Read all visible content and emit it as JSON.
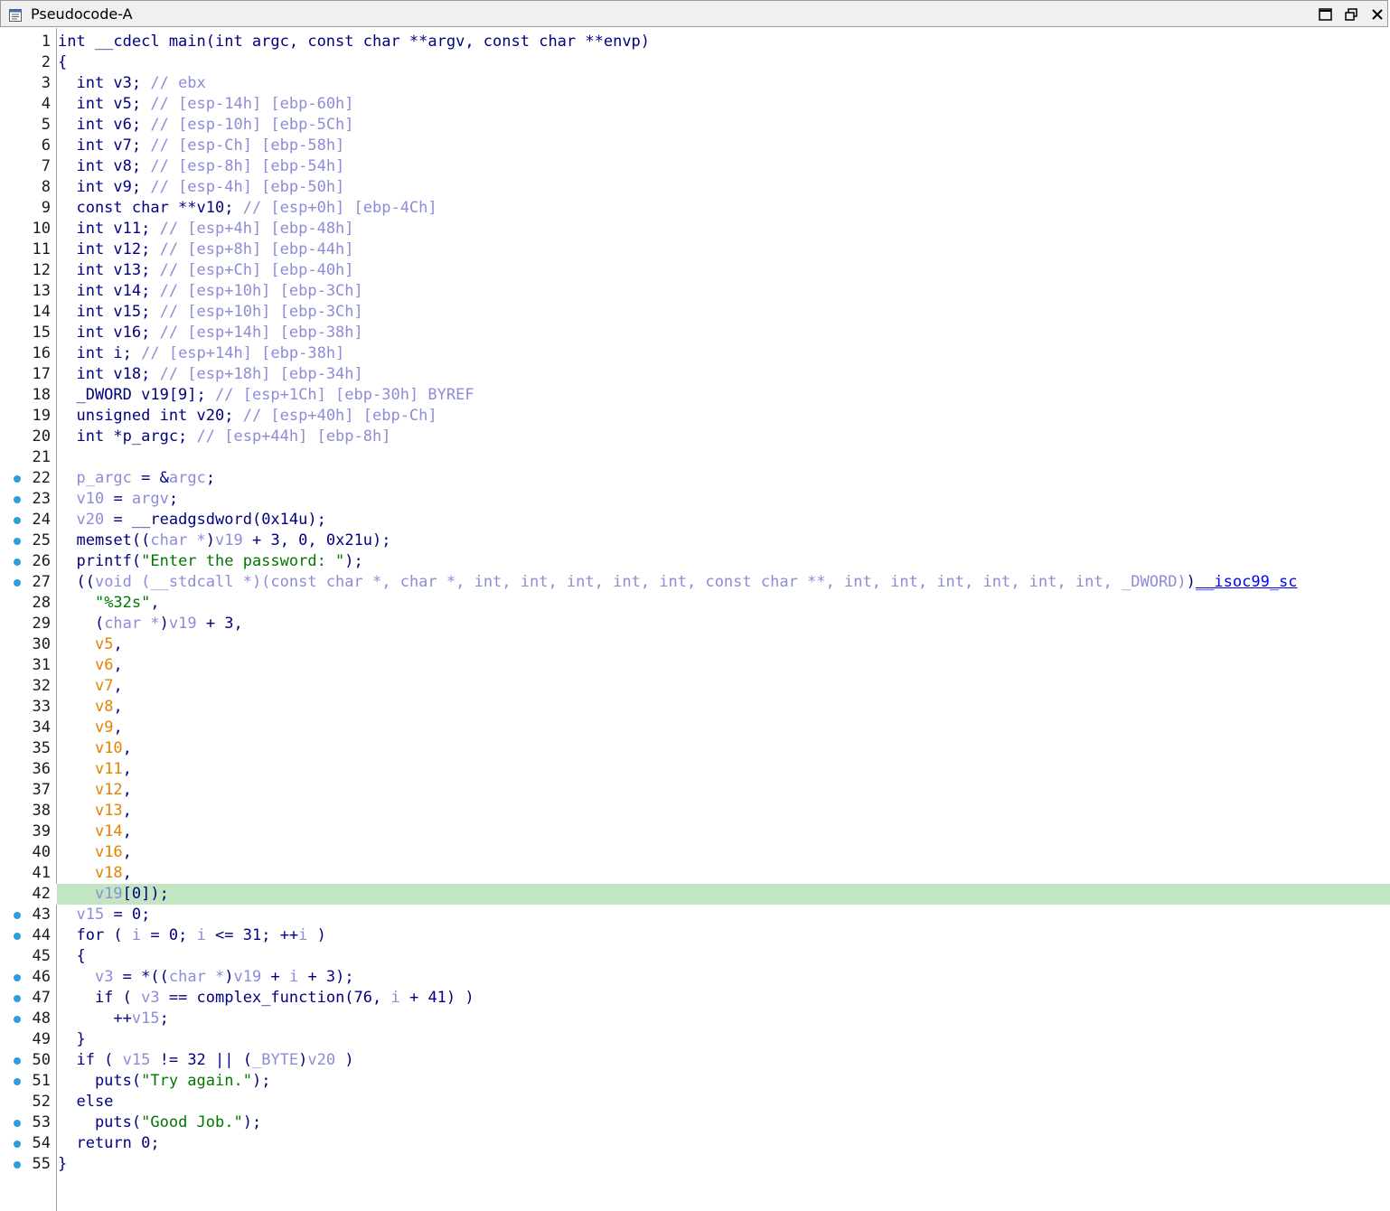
{
  "window": {
    "title": "Pseudocode-A",
    "icon": "pseudocode-view-icon",
    "buttons": [
      "maximize-icon",
      "restore-icon",
      "close-icon"
    ]
  },
  "colors": {
    "keyword": "#000080",
    "comment": "#8c8cd8",
    "variable": "#8c8cd8",
    "argument": "#e68000",
    "string": "#007700",
    "highlight_line": "#c2e6c2",
    "breakpoint_dot": "#2a9fe0"
  },
  "highlighted_line": "42",
  "lines": [
    {
      "n": "1",
      "dot": false,
      "t": [
        [
          "k",
          "int __cdecl main(int argc, const char **argv, const char **envp)"
        ]
      ]
    },
    {
      "n": "2",
      "dot": false,
      "t": [
        [
          "k",
          "{"
        ]
      ]
    },
    {
      "n": "3",
      "dot": false,
      "t": [
        [
          "k",
          "  int v3; "
        ],
        [
          "c",
          "// ebx"
        ]
      ]
    },
    {
      "n": "4",
      "dot": false,
      "t": [
        [
          "k",
          "  int v5; "
        ],
        [
          "c",
          "// [esp-14h] [ebp-60h]"
        ]
      ]
    },
    {
      "n": "5",
      "dot": false,
      "t": [
        [
          "k",
          "  int v6; "
        ],
        [
          "c",
          "// [esp-10h] [ebp-5Ch]"
        ]
      ]
    },
    {
      "n": "6",
      "dot": false,
      "t": [
        [
          "k",
          "  int v7; "
        ],
        [
          "c",
          "// [esp-Ch] [ebp-58h]"
        ]
      ]
    },
    {
      "n": "7",
      "dot": false,
      "t": [
        [
          "k",
          "  int v8; "
        ],
        [
          "c",
          "// [esp-8h] [ebp-54h]"
        ]
      ]
    },
    {
      "n": "8",
      "dot": false,
      "t": [
        [
          "k",
          "  int v9; "
        ],
        [
          "c",
          "// [esp-4h] [ebp-50h]"
        ]
      ]
    },
    {
      "n": "9",
      "dot": false,
      "t": [
        [
          "k",
          "  const char **v10; "
        ],
        [
          "c",
          "// [esp+0h] [ebp-4Ch]"
        ]
      ]
    },
    {
      "n": "10",
      "dot": false,
      "t": [
        [
          "k",
          "  int v11; "
        ],
        [
          "c",
          "// [esp+4h] [ebp-48h]"
        ]
      ]
    },
    {
      "n": "11",
      "dot": false,
      "t": [
        [
          "k",
          "  int v12; "
        ],
        [
          "c",
          "// [esp+8h] [ebp-44h]"
        ]
      ]
    },
    {
      "n": "12",
      "dot": false,
      "t": [
        [
          "k",
          "  int v13; "
        ],
        [
          "c",
          "// [esp+Ch] [ebp-40h]"
        ]
      ]
    },
    {
      "n": "13",
      "dot": false,
      "t": [
        [
          "k",
          "  int v14; "
        ],
        [
          "c",
          "// [esp+10h] [ebp-3Ch]"
        ]
      ]
    },
    {
      "n": "14",
      "dot": false,
      "t": [
        [
          "k",
          "  int v15; "
        ],
        [
          "c",
          "// [esp+10h] [ebp-3Ch]"
        ]
      ]
    },
    {
      "n": "15",
      "dot": false,
      "t": [
        [
          "k",
          "  int v16; "
        ],
        [
          "c",
          "// [esp+14h] [ebp-38h]"
        ]
      ]
    },
    {
      "n": "16",
      "dot": false,
      "t": [
        [
          "k",
          "  int i; "
        ],
        [
          "c",
          "// [esp+14h] [ebp-38h]"
        ]
      ]
    },
    {
      "n": "17",
      "dot": false,
      "t": [
        [
          "k",
          "  int v18; "
        ],
        [
          "c",
          "// [esp+18h] [ebp-34h]"
        ]
      ]
    },
    {
      "n": "18",
      "dot": false,
      "t": [
        [
          "k",
          "  _DWORD v19[9]; "
        ],
        [
          "c",
          "// [esp+1Ch] [ebp-30h] BYREF"
        ]
      ]
    },
    {
      "n": "19",
      "dot": false,
      "t": [
        [
          "k",
          "  unsigned int v20; "
        ],
        [
          "c",
          "// [esp+40h] [ebp-Ch]"
        ]
      ]
    },
    {
      "n": "20",
      "dot": false,
      "t": [
        [
          "k",
          "  int *p_argc; "
        ],
        [
          "c",
          "// [esp+44h] [ebp-8h]"
        ]
      ]
    },
    {
      "n": "21",
      "dot": false,
      "t": [
        [
          "k",
          ""
        ]
      ]
    },
    {
      "n": "22",
      "dot": true,
      "t": [
        [
          "k",
          "  "
        ],
        [
          "v",
          "p_argc"
        ],
        [
          "k",
          " = &"
        ],
        [
          "v",
          "argc"
        ],
        [
          "k",
          ";"
        ]
      ]
    },
    {
      "n": "23",
      "dot": true,
      "t": [
        [
          "k",
          "  "
        ],
        [
          "v",
          "v10"
        ],
        [
          "k",
          " = "
        ],
        [
          "v",
          "argv"
        ],
        [
          "k",
          ";"
        ]
      ]
    },
    {
      "n": "24",
      "dot": true,
      "t": [
        [
          "k",
          "  "
        ],
        [
          "v",
          "v20"
        ],
        [
          "k",
          " = __readgsdword(0x14u);"
        ]
      ]
    },
    {
      "n": "25",
      "dot": true,
      "t": [
        [
          "k",
          "  memset(("
        ],
        [
          "c",
          "char *"
        ],
        [
          "k",
          ")"
        ],
        [
          "v",
          "v19"
        ],
        [
          "k",
          " + 3, 0, 0x21u);"
        ]
      ]
    },
    {
      "n": "26",
      "dot": true,
      "t": [
        [
          "k",
          "  printf("
        ],
        [
          "s",
          "\"Enter the password: \""
        ],
        [
          "k",
          ");"
        ]
      ]
    },
    {
      "n": "27",
      "dot": true,
      "t": [
        [
          "k",
          "  (("
        ],
        [
          "c",
          "void (__stdcall *)(const char *, char *, int, int, int, int, int, const char **, int, int, int, int, int, int, _DWORD)"
        ],
        [
          "k",
          ")"
        ],
        [
          "u",
          "__isoc99_sc"
        ]
      ]
    },
    {
      "n": "28",
      "dot": false,
      "t": [
        [
          "k",
          "    "
        ],
        [
          "s",
          "\"%32s\""
        ],
        [
          "k",
          ","
        ]
      ]
    },
    {
      "n": "29",
      "dot": false,
      "t": [
        [
          "k",
          "    ("
        ],
        [
          "c",
          "char *"
        ],
        [
          "k",
          ")"
        ],
        [
          "v",
          "v19"
        ],
        [
          "k",
          " + 3,"
        ]
      ]
    },
    {
      "n": "30",
      "dot": false,
      "t": [
        [
          "k",
          "    "
        ],
        [
          "o",
          "v5"
        ],
        [
          "k",
          ","
        ]
      ]
    },
    {
      "n": "31",
      "dot": false,
      "t": [
        [
          "k",
          "    "
        ],
        [
          "o",
          "v6"
        ],
        [
          "k",
          ","
        ]
      ]
    },
    {
      "n": "32",
      "dot": false,
      "t": [
        [
          "k",
          "    "
        ],
        [
          "o",
          "v7"
        ],
        [
          "k",
          ","
        ]
      ]
    },
    {
      "n": "33",
      "dot": false,
      "t": [
        [
          "k",
          "    "
        ],
        [
          "o",
          "v8"
        ],
        [
          "k",
          ","
        ]
      ]
    },
    {
      "n": "34",
      "dot": false,
      "t": [
        [
          "k",
          "    "
        ],
        [
          "o",
          "v9"
        ],
        [
          "k",
          ","
        ]
      ]
    },
    {
      "n": "35",
      "dot": false,
      "t": [
        [
          "k",
          "    "
        ],
        [
          "o",
          "v10"
        ],
        [
          "k",
          ","
        ]
      ]
    },
    {
      "n": "36",
      "dot": false,
      "t": [
        [
          "k",
          "    "
        ],
        [
          "o",
          "v11"
        ],
        [
          "k",
          ","
        ]
      ]
    },
    {
      "n": "37",
      "dot": false,
      "t": [
        [
          "k",
          "    "
        ],
        [
          "o",
          "v12"
        ],
        [
          "k",
          ","
        ]
      ]
    },
    {
      "n": "38",
      "dot": false,
      "t": [
        [
          "k",
          "    "
        ],
        [
          "o",
          "v13"
        ],
        [
          "k",
          ","
        ]
      ]
    },
    {
      "n": "39",
      "dot": false,
      "t": [
        [
          "k",
          "    "
        ],
        [
          "o",
          "v14"
        ],
        [
          "k",
          ","
        ]
      ]
    },
    {
      "n": "40",
      "dot": false,
      "t": [
        [
          "k",
          "    "
        ],
        [
          "o",
          "v16"
        ],
        [
          "k",
          ","
        ]
      ]
    },
    {
      "n": "41",
      "dot": false,
      "t": [
        [
          "k",
          "    "
        ],
        [
          "o",
          "v18"
        ],
        [
          "k",
          ","
        ]
      ]
    },
    {
      "n": "42",
      "dot": false,
      "t": [
        [
          "k",
          "    "
        ],
        [
          "v",
          "v19"
        ],
        [
          "k",
          "[0]);"
        ]
      ]
    },
    {
      "n": "43",
      "dot": true,
      "t": [
        [
          "k",
          "  "
        ],
        [
          "v",
          "v15"
        ],
        [
          "k",
          " = 0;"
        ]
      ]
    },
    {
      "n": "44",
      "dot": true,
      "t": [
        [
          "k",
          "  for ( "
        ],
        [
          "v",
          "i"
        ],
        [
          "k",
          " = 0; "
        ],
        [
          "v",
          "i"
        ],
        [
          "k",
          " <= 31; ++"
        ],
        [
          "v",
          "i"
        ],
        [
          "k",
          " )"
        ]
      ]
    },
    {
      "n": "45",
      "dot": false,
      "t": [
        [
          "k",
          "  {"
        ]
      ]
    },
    {
      "n": "46",
      "dot": true,
      "t": [
        [
          "k",
          "    "
        ],
        [
          "v",
          "v3"
        ],
        [
          "k",
          " = *(("
        ],
        [
          "c",
          "char *"
        ],
        [
          "k",
          ")"
        ],
        [
          "v",
          "v19"
        ],
        [
          "k",
          " + "
        ],
        [
          "v",
          "i"
        ],
        [
          "k",
          " + 3);"
        ]
      ]
    },
    {
      "n": "47",
      "dot": true,
      "t": [
        [
          "k",
          "    if ( "
        ],
        [
          "v",
          "v3"
        ],
        [
          "k",
          " == complex_function(76, "
        ],
        [
          "v",
          "i"
        ],
        [
          "k",
          " + 41) )"
        ]
      ]
    },
    {
      "n": "48",
      "dot": true,
      "t": [
        [
          "k",
          "      ++"
        ],
        [
          "v",
          "v15"
        ],
        [
          "k",
          ";"
        ]
      ]
    },
    {
      "n": "49",
      "dot": false,
      "t": [
        [
          "k",
          "  }"
        ]
      ]
    },
    {
      "n": "50",
      "dot": true,
      "t": [
        [
          "k",
          "  if ( "
        ],
        [
          "v",
          "v15"
        ],
        [
          "k",
          " != 32 || ("
        ],
        [
          "c",
          "_BYTE"
        ],
        [
          "k",
          ")"
        ],
        [
          "v",
          "v20"
        ],
        [
          "k",
          " )"
        ]
      ]
    },
    {
      "n": "51",
      "dot": true,
      "t": [
        [
          "k",
          "    puts("
        ],
        [
          "s",
          "\"Try again.\""
        ],
        [
          "k",
          ");"
        ]
      ]
    },
    {
      "n": "52",
      "dot": false,
      "t": [
        [
          "k",
          "  else"
        ]
      ]
    },
    {
      "n": "53",
      "dot": true,
      "t": [
        [
          "k",
          "    puts("
        ],
        [
          "s",
          "\"Good Job.\""
        ],
        [
          "k",
          ");"
        ]
      ]
    },
    {
      "n": "54",
      "dot": true,
      "t": [
        [
          "k",
          "  return 0;"
        ]
      ]
    },
    {
      "n": "55",
      "dot": true,
      "t": [
        [
          "k",
          "}"
        ]
      ]
    }
  ]
}
